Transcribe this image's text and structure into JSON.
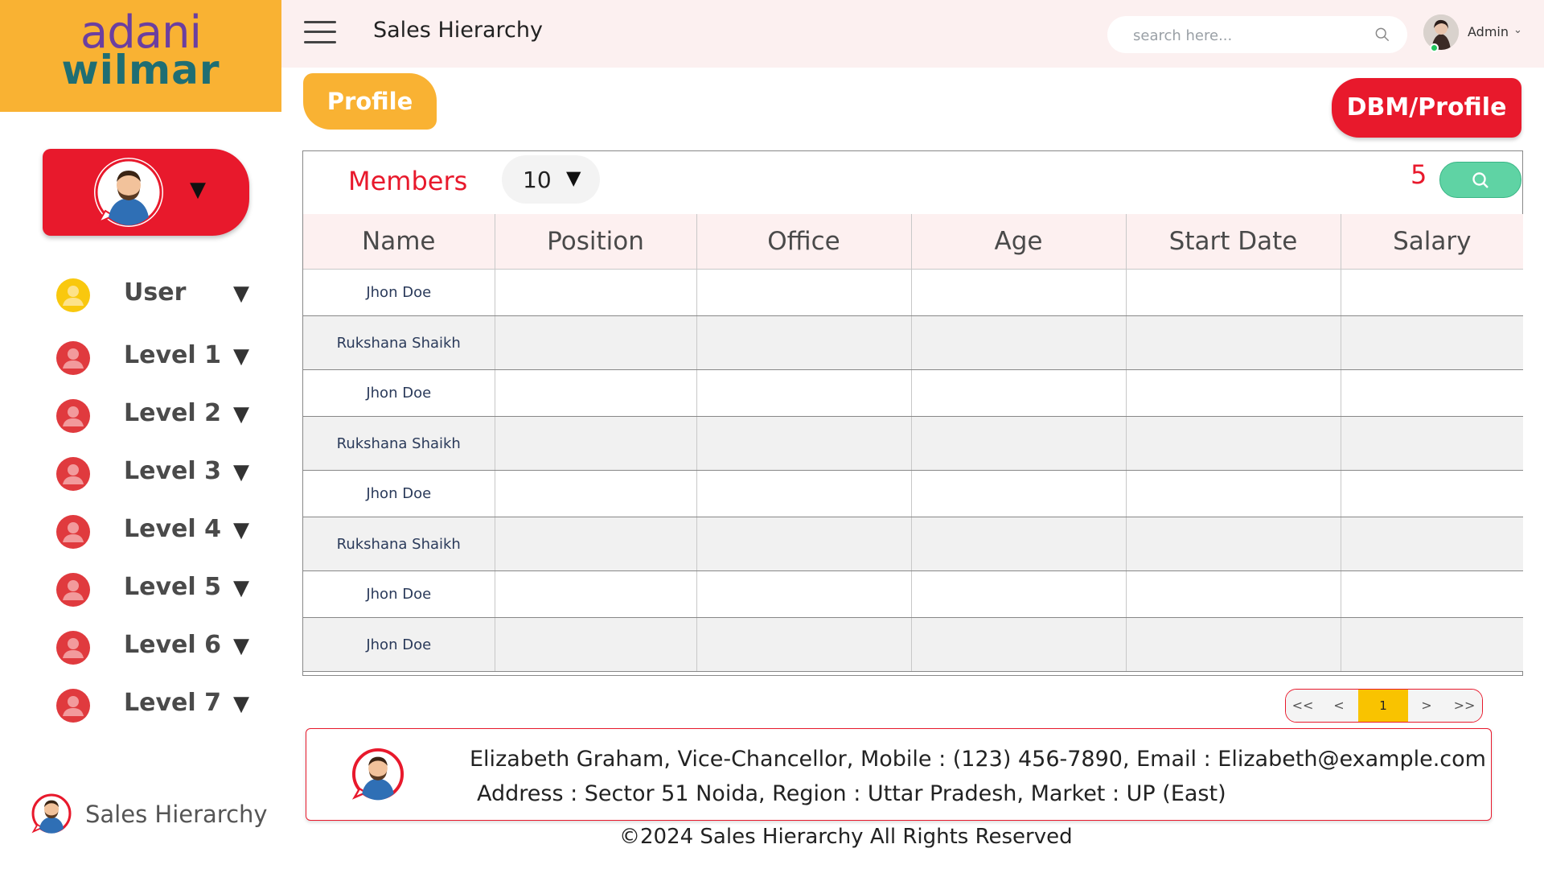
{
  "brand": {
    "line1": "adani",
    "line2": "wilmar"
  },
  "header": {
    "title": "Sales Hierarchy",
    "search_placeholder": "search here...",
    "user_label": "Admin"
  },
  "sidebar": {
    "items": [
      {
        "label": "User",
        "color": "#f9c80e"
      },
      {
        "label": "Level 1",
        "color": "#e03a3e"
      },
      {
        "label": "Level 2",
        "color": "#e03a3e"
      },
      {
        "label": "Level 3",
        "color": "#e03a3e"
      },
      {
        "label": "Level 4",
        "color": "#e03a3e"
      },
      {
        "label": "Level 5",
        "color": "#e03a3e"
      },
      {
        "label": "Level 6",
        "color": "#e03a3e"
      },
      {
        "label": "Level 7",
        "color": "#e03a3e"
      }
    ],
    "footer_label": "Sales Hierarchy"
  },
  "buttons": {
    "profile": "Profile",
    "dbm_profile": "DBM/Profile"
  },
  "members": {
    "label": "Members",
    "page_size": "10",
    "count": "5"
  },
  "table": {
    "columns": [
      "Name",
      "Position",
      "Office",
      "Age",
      "Start Date",
      "Salary"
    ],
    "rows": [
      {
        "name": "Jhon Doe"
      },
      {
        "name": "Rukshana Shaikh"
      },
      {
        "name": "Jhon Doe"
      },
      {
        "name": "Rukshana Shaikh"
      },
      {
        "name": "Jhon Doe"
      },
      {
        "name": "Rukshana Shaikh"
      },
      {
        "name": "Jhon Doe"
      },
      {
        "name": "Jhon Doe"
      }
    ]
  },
  "pagination": {
    "first": "<<",
    "prev": "<",
    "current": "1",
    "next": ">",
    "last": ">>"
  },
  "info": {
    "line1": "Elizabeth Graham, Vice-Chancellor, Mobile : (123) 456-7890, Email : Elizabeth@example.com",
    "line2": "Address : Sector 51 Noida, Region : Uttar Pradesh, Market : UP (East)"
  },
  "footer": {
    "copyright": "©2024 Sales Hierarchy All Rights Reserved"
  },
  "colors": {
    "brand_orange": "#f9b233",
    "accent_red": "#e8192c",
    "header_bg": "#fcf0f0",
    "search_green": "#5fd3a4"
  }
}
